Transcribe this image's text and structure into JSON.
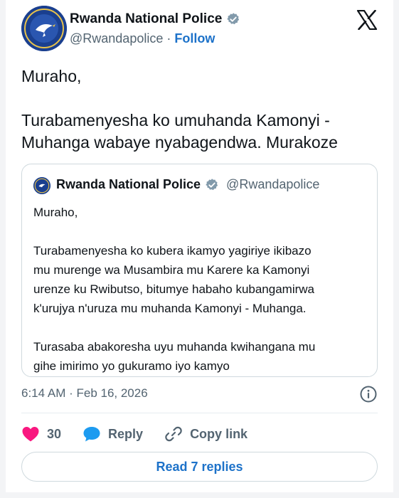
{
  "author": {
    "display_name": "Rwanda National Police",
    "handle": "@Rwandapolice",
    "separator": "·",
    "follow_label": "Follow"
  },
  "tweet": {
    "lines": [
      "Muraho,",
      "",
      "Turabamenyesha ko umuhanda Kamonyi -",
      "Muhanga wabaye nyabagendwa. Murakoze"
    ]
  },
  "quoted": {
    "display_name": "Rwanda National Police",
    "handle": "@Rwandapolice",
    "lines": [
      "Muraho,",
      "",
      "Turabamenyesha ko kubera ikamyo yagiriye ikibazo",
      "mu murenge wa Musambira mu Karere ka Kamonyi",
      "urenze ku Rwibutso, bitumye habaho kubangamirwa",
      "k'urujya n'uruza mu muhanda Kamonyi - Muhanga.",
      "",
      "Turasaba abakoresha uyu muhanda kwihangana mu",
      "gihe imirimo yo gukuramo iyo kamyo"
    ]
  },
  "meta": {
    "timestamp": "6:14 AM · Feb 16, 2026"
  },
  "actions": {
    "like_count": "30",
    "reply_label": "Reply",
    "copy_link_label": "Copy link"
  },
  "footer": {
    "read_replies_label": "Read 7 replies"
  },
  "icons": {
    "avatar": "police-logo-icon",
    "verified": "verified-badge-icon",
    "brand": "x-logo-icon",
    "info": "info-icon",
    "like": "heart-icon",
    "reply": "reply-bubble-icon",
    "copy": "link-icon"
  },
  "colors": {
    "link_blue": "#1d72c9",
    "like_pink": "#f91880",
    "reply_blue": "#1d9bf0",
    "muted_text": "#536471",
    "border": "#cfd9de"
  }
}
